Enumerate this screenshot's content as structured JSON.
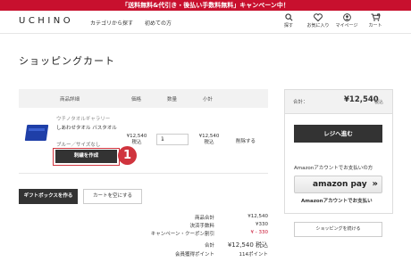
{
  "banner": {
    "text": "「送料無料&代引き・後払い手数料無料」キャンペーン中！"
  },
  "header": {
    "logo": "UCHINO",
    "nav": [
      "カテゴリから探す",
      "初めての方"
    ],
    "icons": [
      {
        "icon": "search-icon",
        "label": "探す"
      },
      {
        "icon": "heart-icon",
        "label": "お気に入り"
      },
      {
        "icon": "user-icon",
        "label": "マイページ"
      },
      {
        "icon": "cart-icon",
        "label": "カート",
        "badge": "1"
      }
    ]
  },
  "page": {
    "title": "ショッピングカート"
  },
  "table": {
    "headers": {
      "product": "商品詳細",
      "price": "価格",
      "qty": "数量",
      "subtotal": "小計"
    },
    "item": {
      "brand": "ウチノタオルギャラリー",
      "name": "しあわせタオル バスタオル",
      "option": "ブルー／サイズなし",
      "create_button": "刺繍を作成",
      "price": "¥12,540",
      "price_tax": "税込",
      "qty": "1",
      "subtotal": "¥12,540",
      "subtotal_tax": "税込",
      "delete": "削除する"
    }
  },
  "annotation": {
    "number": "1"
  },
  "buttons": {
    "giftbox": "ギフトボックスを作る",
    "empty_cart": "カートを空にする"
  },
  "totals": [
    {
      "label": "商品合計",
      "value": "¥12,540"
    },
    {
      "label": "決済手数料",
      "value": "¥330"
    },
    {
      "label": "キャンペーン・クーポン割引",
      "value": "¥ - 330"
    },
    {
      "label": "合計",
      "value": "¥12,540 税込"
    },
    {
      "label": "会員獲得ポイント",
      "value": "114ポイント"
    }
  ],
  "sidebar": {
    "total_label": "合計：",
    "total_value": "¥12,540",
    "total_tax": "税込",
    "checkout": "レジへ進む",
    "amazon_note": "Amazonアカウントでお支払いの方",
    "amazon_pay": "amazon pay",
    "amazon_sub": "Amazonアカウントでお支払い",
    "continue": "ショッピングを続ける"
  },
  "colors": {
    "banner": "#c8102e",
    "accent_red": "#d0343e",
    "dark_button": "#333333"
  }
}
